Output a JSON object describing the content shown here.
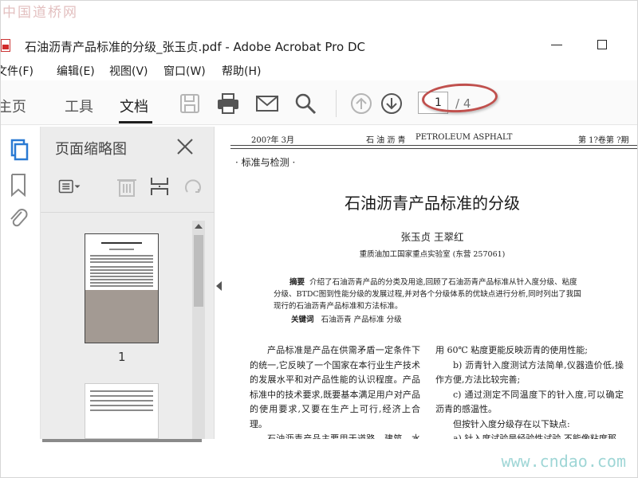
{
  "watermarks": {
    "top": "中国道桥网",
    "bottom": "www.cndao.com"
  },
  "window": {
    "title": "石油沥青产品标准的分级_张玉贞.pdf - Adobe Acrobat Pro DC"
  },
  "menu": [
    "文件(F)",
    "编辑(E)",
    "视图(V)",
    "窗口(W)",
    "帮助(H)"
  ],
  "nav_tabs": [
    "主页",
    "工具",
    "文档"
  ],
  "active_tab": "文档",
  "toolbar": {
    "current_page": "1",
    "total_pages": "/ 4"
  },
  "icons": [
    "save-icon",
    "print-icon",
    "email-icon",
    "search-icon",
    "page-up-icon",
    "page-down-icon"
  ],
  "thumbnails": {
    "panel_title": "页面缩略图",
    "page_label": "1"
  },
  "document": {
    "header_date": "200?年 3月",
    "header_journal": "石 油 沥 青",
    "header_en": "PETROLEUM ASPHALT",
    "header_vol": "第 1?卷第 ?期",
    "section": "· 标准与检测 ·",
    "title": "石油沥青产品标准的分级",
    "authors": "张玉贞   王翠红",
    "affiliation": "重质油加工国家重点实验室 (东营 257061)",
    "abstract_label": "摘要",
    "abstract_text": "介绍了石油沥青产品的分类及用途,回顾了石油沥青产品标准从针入度分级、粘度分级、BTDC图到性能分级的发展过程,并对各个分级体系的优缺点进行分析,同时列出了我国现行的石油沥青产品标准和方法标准。",
    "keywords_label": "关键词",
    "keywords": "石油沥青   产品标准   分级",
    "col1": [
      "产品标准是产品在供需矛盾一定条件下的统一,它反映了一个国家在本行业生产技术的发展水平和对产品性能的认识程度。产品标准中的技术要求,既要基本满足用户对产品的使用要求,又要在生产上可行,经济上合理。",
      "石油沥青产品主要用于道路、建筑、水利、防腐、防腐、电器绝缘等工程建设,是国民经济建"
    ],
    "col2": [
      "用 60℃ 粘度更能反映沥青的使用性能;",
      "b) 沥青针入度测试方法简单,仪器造价低,操作方便,方法比较完善;",
      "c) 通过测定不同温度下的针入度,可以确定沥青的感温性。",
      "但按针入度分级存在以下缺点:",
      "a) 针入度试验是经验性试验,不能像粘度那"
    ]
  }
}
